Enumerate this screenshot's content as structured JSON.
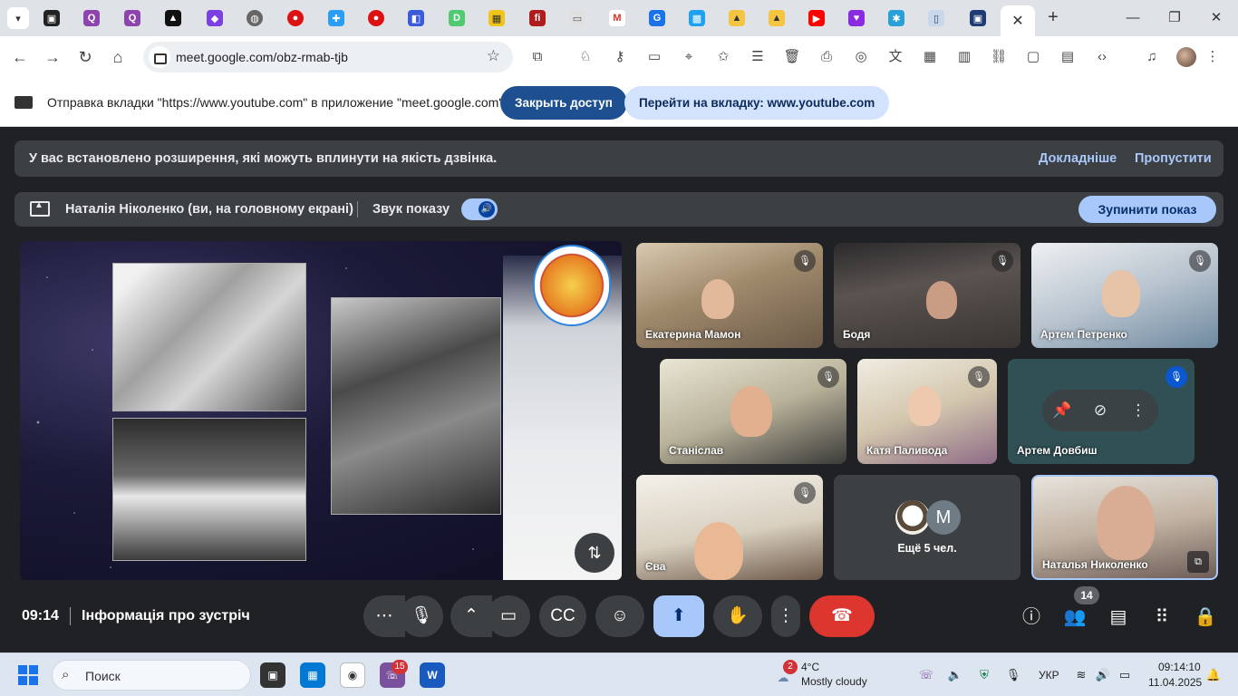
{
  "browser": {
    "url": "meet.google.com/obz-rmab-tjb",
    "tab_close": "✕",
    "new_tab": "+"
  },
  "sharing_bar": {
    "message": "Отправка вкладки \"https://www.youtube.com\" в приложение \"meet.google.com\"...",
    "stop_button": "Закрыть доступ",
    "goto_button": "Перейти на вкладку: www.youtube.com"
  },
  "banner": {
    "message": "У вас встановлено розширення, які можуть вплинути на якість дзвінка.",
    "more": "Докладніше",
    "skip": "Пропустити"
  },
  "presenting": {
    "name": "Наталія Ніколенко (ви, на головному екрані)",
    "sound_label": "Звук показу",
    "stop_button": "Зупинити показ"
  },
  "participants": [
    {
      "name": "Екатерина Мамон",
      "muted": true
    },
    {
      "name": "Бодя",
      "muted": true
    },
    {
      "name": "Артем Петренко",
      "muted": true
    },
    {
      "name": "Станіслав",
      "muted": true
    },
    {
      "name": "Катя Паливода",
      "muted": true
    },
    {
      "name": "Артем Довбиш",
      "muted": true
    },
    {
      "name": "Єва",
      "muted": true
    },
    {
      "name": "Наталья Николенко",
      "muted": false
    }
  ],
  "more_tile": {
    "avatar_letter": "M",
    "label": "Ещё 5 чел."
  },
  "bottom_bar": {
    "time": "09:14",
    "meeting_info": "Інформація про зустріч",
    "people_count": "14"
  },
  "taskbar": {
    "search_placeholder": "Поиск",
    "viber_badge": "15",
    "weather_badge": "2",
    "weather_temp": "4°C",
    "weather_desc": "Mostly cloudy",
    "language": "УКР",
    "clock_time": "09:14:10",
    "clock_date": "11.04.2025"
  },
  "colors": {
    "meet_bg": "#202124",
    "accent_blue": "#a8c7fa",
    "end_call_red": "#dc362e",
    "share_button_dark": "#1d4f91"
  }
}
